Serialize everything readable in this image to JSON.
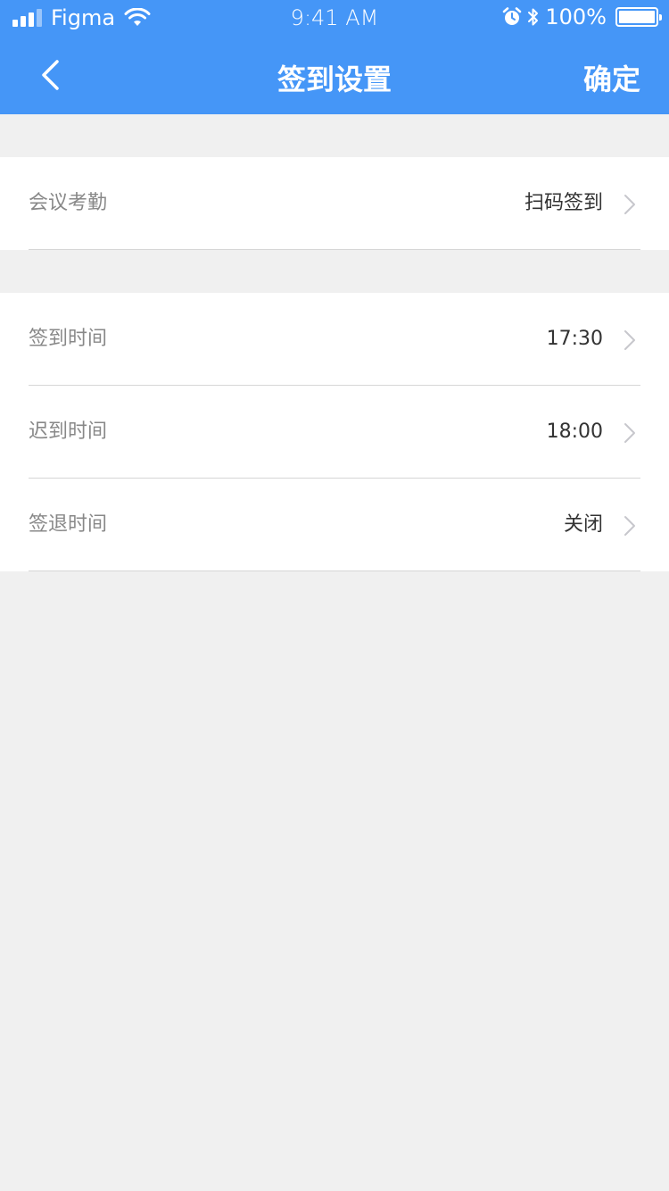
{
  "status_bar": {
    "carrier": "Figma",
    "time": "9:41 AM",
    "battery": "100%"
  },
  "nav": {
    "title": "签到设置",
    "confirm": "确定",
    "back_icon": "chevron-left-icon"
  },
  "groups": [
    {
      "rows": [
        {
          "label": "会议考勤",
          "value": "扫码签到"
        }
      ]
    },
    {
      "rows": [
        {
          "label": "签到时间",
          "value": "17:30"
        },
        {
          "label": "迟到时间",
          "value": "18:00"
        },
        {
          "label": "签退时间",
          "value": "关闭"
        }
      ]
    }
  ],
  "colors": {
    "primary": "#4596f7",
    "background": "#f0f0f0"
  }
}
